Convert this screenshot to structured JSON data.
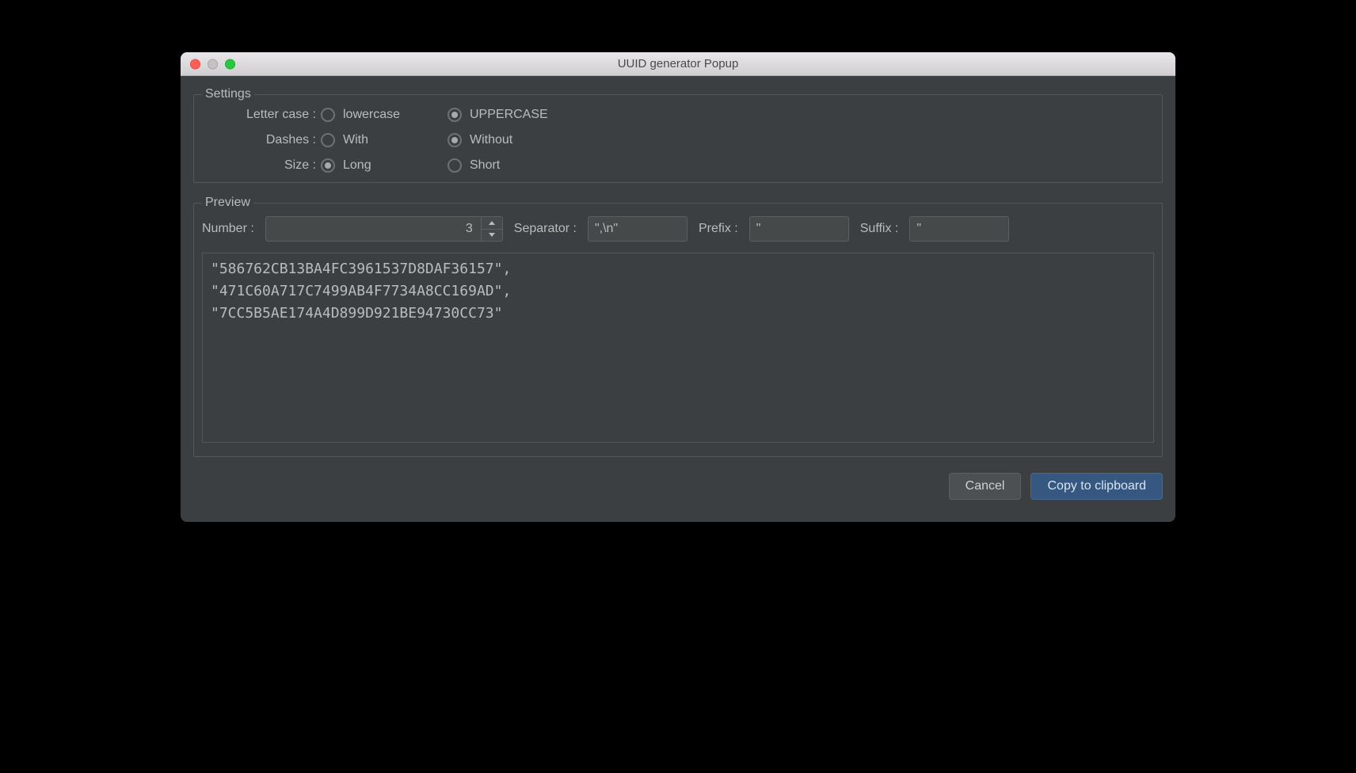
{
  "window": {
    "title": "UUID generator Popup"
  },
  "settings": {
    "legend": "Settings",
    "letterCase": {
      "label": "Letter case :",
      "options": [
        {
          "label": "lowercase",
          "selected": false
        },
        {
          "label": "UPPERCASE",
          "selected": true
        }
      ]
    },
    "dashes": {
      "label": "Dashes :",
      "options": [
        {
          "label": "With",
          "selected": false
        },
        {
          "label": "Without",
          "selected": true
        }
      ]
    },
    "size": {
      "label": "Size :",
      "options": [
        {
          "label": "Long",
          "selected": true
        },
        {
          "label": "Short",
          "selected": false
        }
      ]
    }
  },
  "preview": {
    "legend": "Preview",
    "number": {
      "label": "Number :",
      "value": "3"
    },
    "separator": {
      "label": "Separator :",
      "value": "\",\\n\""
    },
    "prefix": {
      "label": "Prefix :",
      "value": "\""
    },
    "suffix": {
      "label": "Suffix :",
      "value": "\""
    },
    "output": "\"586762CB13BA4FC3961537D8DAF36157\",\n\"471C60A717C7499AB4F7734A8CC169AD\",\n\"7CC5B5AE174A4D899D921BE94730CC73\""
  },
  "buttons": {
    "cancel": "Cancel",
    "copy": "Copy to clipboard"
  }
}
